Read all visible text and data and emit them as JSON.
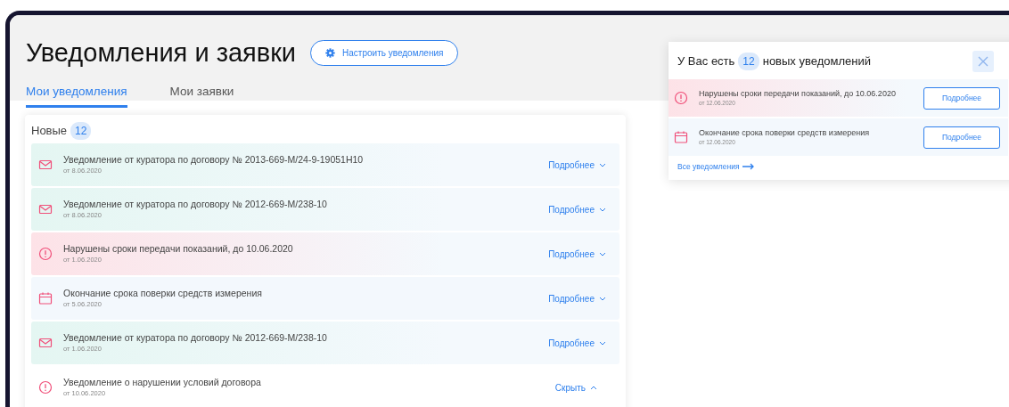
{
  "header": {
    "title": "Уведомления и заявки",
    "settings_button": "Настроить уведомления"
  },
  "tabs": [
    {
      "label": "Мои уведомления",
      "selected": true
    },
    {
      "label": "Мои заявки",
      "selected": false
    }
  ],
  "list": {
    "title": "Новые",
    "count": "12",
    "items": [
      {
        "kind": "mail",
        "title": "Уведомление от куратора по договору № 2013-669-М/24-9-19051Н10",
        "date": "от 8.06.2020",
        "action": "Подробнее",
        "expanded": false
      },
      {
        "kind": "mail",
        "title": "Уведомление от куратора по договору № 2012-669-М/238-10",
        "date": "от 8.06.2020",
        "action": "Подробнее",
        "expanded": false
      },
      {
        "kind": "alert",
        "title": "Нарушены сроки передачи показаний, до 10.06.2020",
        "date": "от 1.06.2020",
        "action": "Подробнее",
        "expanded": false
      },
      {
        "kind": "calendar",
        "title": "Окончание срока поверки средств измерения",
        "date": "от 5.06.2020",
        "action": "Подробнее",
        "expanded": false
      },
      {
        "kind": "mail",
        "title": "Уведомление от куратора по договору № 2012-669-М/238-10",
        "date": "от 1.06.2020",
        "action": "Подробнее",
        "expanded": false
      },
      {
        "kind": "alert",
        "title": "Уведомление о нарушении условий договора",
        "date": "от 10.06.2020",
        "action": "Скрыть",
        "expanded": true
      }
    ]
  },
  "popup": {
    "title_before": "У Вас есть",
    "count": "12",
    "title_after": "новых уведомлений",
    "items": [
      {
        "kind": "alert",
        "title": "Нарушены сроки передачи показаний, до 10.06.2020",
        "date": "от 12.06.2020",
        "button": "Подробнее"
      },
      {
        "kind": "calendar",
        "title": "Окончание срока поверки средств измерения",
        "date": "от 12.06.2020",
        "button": "Подробнее"
      }
    ],
    "all_link": "Все уведомления"
  }
}
